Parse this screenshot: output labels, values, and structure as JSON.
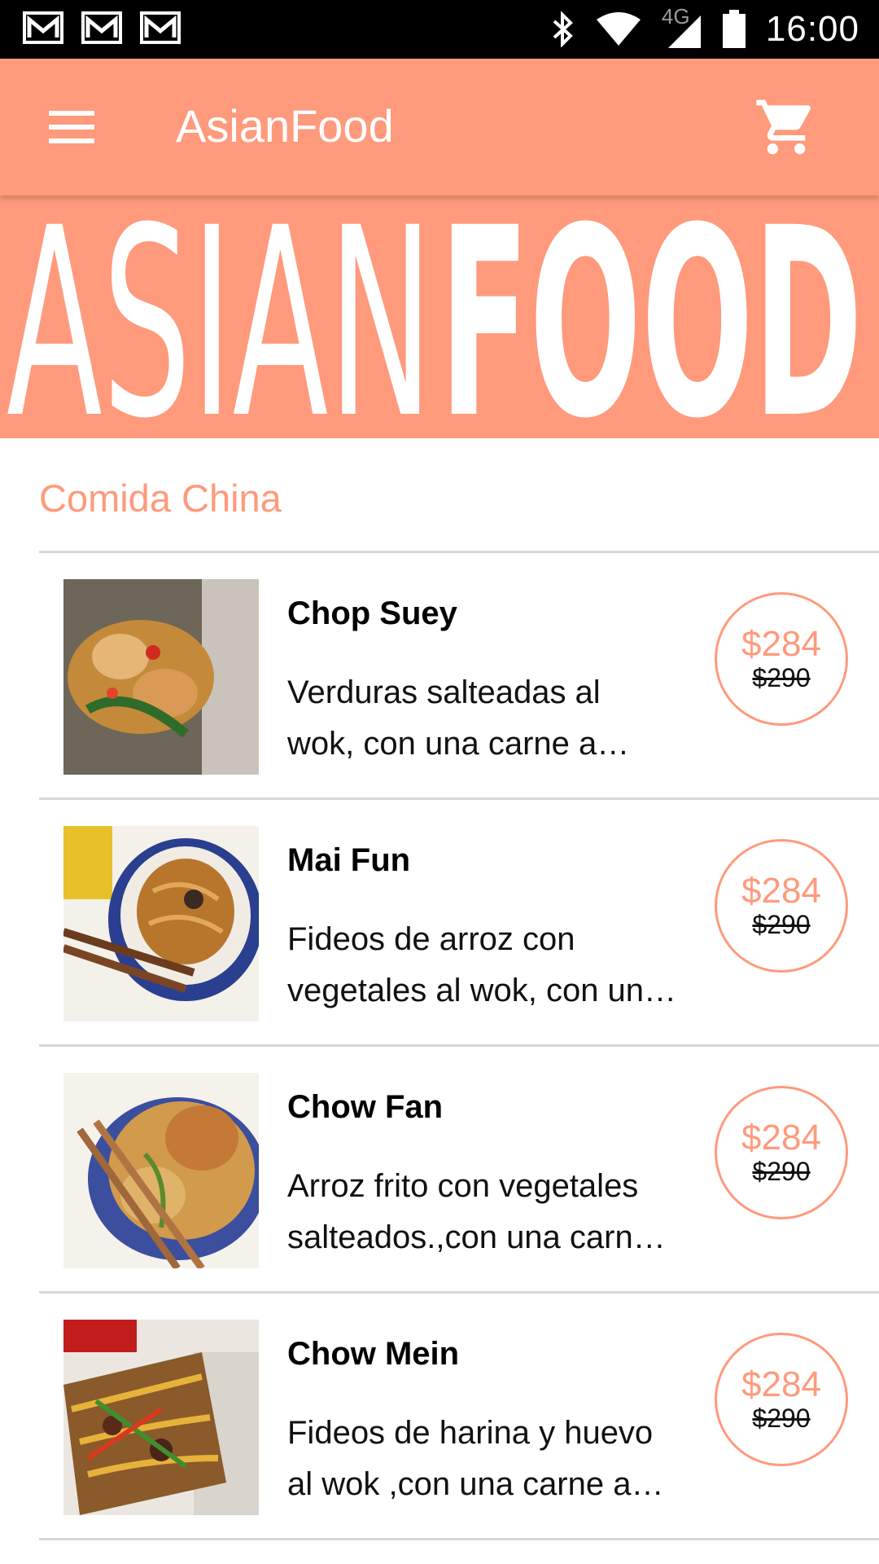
{
  "status_bar": {
    "time": "16:00",
    "network": "4G",
    "icons": [
      "gmail-icon",
      "gmail-icon",
      "gmail-icon",
      "bluetooth-icon",
      "wifi-icon",
      "signal-icon",
      "battery-icon"
    ]
  },
  "toolbar": {
    "title": "AsianFood",
    "menu_icon": "menu-icon",
    "cart_icon": "shopping-cart-icon"
  },
  "banner": {
    "word_light": "ASIAN",
    "word_bold": "FOOD"
  },
  "section": {
    "title": "Comida China"
  },
  "items": [
    {
      "name": "Chop Suey",
      "desc_line1": "Verduras salteadas al",
      "desc_line2": "wok, con una carne a…",
      "price": "$284",
      "old_price": "$290"
    },
    {
      "name": "Mai Fun",
      "desc_line1": "Fideos de arroz con",
      "desc_line2": "vegetales al wok, con un…",
      "price": "$284",
      "old_price": "$290"
    },
    {
      "name": "Chow Fan",
      "desc_line1": "Arroz frito con vegetales",
      "desc_line2": "salteados.,con una carn…",
      "price": "$284",
      "old_price": "$290"
    },
    {
      "name": "Chow Mein",
      "desc_line1": "Fideos de harina y huevo",
      "desc_line2": "al wok ,con una carne a…",
      "price": "$284",
      "old_price": "$290"
    }
  ],
  "colors": {
    "accent": "#ff9a7c",
    "status_bar": "#000000",
    "divider": "#d8d8d8"
  }
}
